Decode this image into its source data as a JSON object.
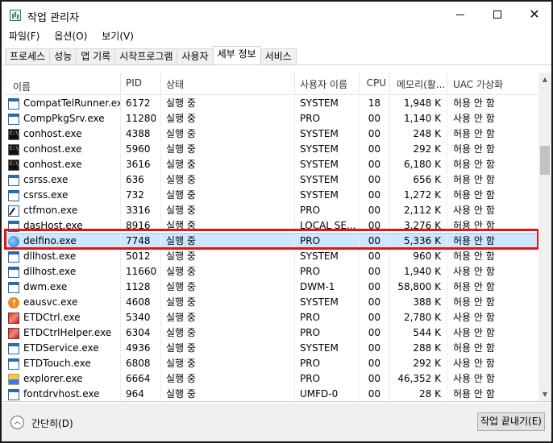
{
  "window": {
    "title": "작업 관리자"
  },
  "menu": [
    "파일(F)",
    "옵션(O)",
    "보기(V)"
  ],
  "tabs": [
    "프로세스",
    "성능",
    "앱 기록",
    "시작프로그램",
    "사용자",
    "세부 정보",
    "서비스"
  ],
  "active_tab": "세부 정보",
  "columns": {
    "name": "이름",
    "pid": "PID",
    "state": "상태",
    "user": "사용자 이름",
    "cpu": "CPU",
    "mem": "메모리(활...",
    "uac": "UAC 가상화"
  },
  "rows": [
    {
      "icon": "window-icon",
      "name": "CompatTelRunner.exe",
      "pid": "6172",
      "state": "실행 중",
      "user": "SYSTEM",
      "cpu": "18",
      "mem": "1,948 K",
      "uac": "허용 안 함"
    },
    {
      "icon": "window-icon",
      "name": "CompPkgSrv.exe",
      "pid": "11280",
      "state": "실행 중",
      "user": "PRO",
      "cpu": "00",
      "mem": "1,140 K",
      "uac": "사용 안 함"
    },
    {
      "icon": "console-icon",
      "name": "conhost.exe",
      "pid": "4388",
      "state": "실행 중",
      "user": "SYSTEM",
      "cpu": "00",
      "mem": "248 K",
      "uac": "허용 안 함"
    },
    {
      "icon": "console-icon",
      "name": "conhost.exe",
      "pid": "5960",
      "state": "실행 중",
      "user": "SYSTEM",
      "cpu": "00",
      "mem": "292 K",
      "uac": "허용 안 함"
    },
    {
      "icon": "console-icon",
      "name": "conhost.exe",
      "pid": "3616",
      "state": "실행 중",
      "user": "SYSTEM",
      "cpu": "00",
      "mem": "6,180 K",
      "uac": "허용 안 함"
    },
    {
      "icon": "window-icon",
      "name": "csrss.exe",
      "pid": "636",
      "state": "실행 중",
      "user": "SYSTEM",
      "cpu": "00",
      "mem": "656 K",
      "uac": "허용 안 함"
    },
    {
      "icon": "window-icon",
      "name": "csrss.exe",
      "pid": "732",
      "state": "실행 중",
      "user": "SYSTEM",
      "cpu": "00",
      "mem": "1,272 K",
      "uac": "허용 안 함"
    },
    {
      "icon": "pen-icon",
      "name": "ctfmon.exe",
      "pid": "3316",
      "state": "실행 중",
      "user": "PRO",
      "cpu": "00",
      "mem": "2,112 K",
      "uac": "사용 안 함"
    },
    {
      "icon": "window-icon",
      "name": "dasHost.exe",
      "pid": "8916",
      "state": "실행 중",
      "user": "LOCAL SE...",
      "cpu": "00",
      "mem": "3,276 K",
      "uac": "허용 안 함"
    },
    {
      "icon": "globe-icon",
      "name": "delfino.exe",
      "pid": "7748",
      "state": "실행 중",
      "user": "PRO",
      "cpu": "00",
      "mem": "5,336 K",
      "uac": "허용 안 함",
      "selected": true
    },
    {
      "icon": "window-icon",
      "name": "dllhost.exe",
      "pid": "5012",
      "state": "실행 중",
      "user": "SYSTEM",
      "cpu": "00",
      "mem": "960 K",
      "uac": "허용 안 함"
    },
    {
      "icon": "window-icon",
      "name": "dllhost.exe",
      "pid": "11660",
      "state": "실행 중",
      "user": "PRO",
      "cpu": "00",
      "mem": "1,940 K",
      "uac": "사용 안 함"
    },
    {
      "icon": "window-icon",
      "name": "dwm.exe",
      "pid": "1128",
      "state": "실행 중",
      "user": "DWM-1",
      "cpu": "00",
      "mem": "58,800 K",
      "uac": "허용 안 함"
    },
    {
      "icon": "update-icon",
      "name": "eausvc.exe",
      "pid": "4608",
      "state": "실행 중",
      "user": "SYSTEM",
      "cpu": "00",
      "mem": "388 K",
      "uac": "허용 안 함"
    },
    {
      "icon": "etd-icon",
      "name": "ETDCtrl.exe",
      "pid": "5340",
      "state": "실행 중",
      "user": "PRO",
      "cpu": "00",
      "mem": "2,780 K",
      "uac": "사용 안 함"
    },
    {
      "icon": "etd-icon",
      "name": "ETDCtrlHelper.exe",
      "pid": "6304",
      "state": "실행 중",
      "user": "PRO",
      "cpu": "00",
      "mem": "544 K",
      "uac": "사용 안 함"
    },
    {
      "icon": "window-icon",
      "name": "ETDService.exe",
      "pid": "4936",
      "state": "실행 중",
      "user": "SYSTEM",
      "cpu": "00",
      "mem": "288 K",
      "uac": "허용 안 함"
    },
    {
      "icon": "window-icon",
      "name": "ETDTouch.exe",
      "pid": "6808",
      "state": "실행 중",
      "user": "PRO",
      "cpu": "00",
      "mem": "292 K",
      "uac": "사용 안 함"
    },
    {
      "icon": "folder-icon",
      "name": "explorer.exe",
      "pid": "6664",
      "state": "실행 중",
      "user": "PRO",
      "cpu": "00",
      "mem": "46,352 K",
      "uac": "사용 안 함"
    },
    {
      "icon": "window-icon",
      "name": "fontdrvhost.exe",
      "pid": "964",
      "state": "실행 중",
      "user": "UMFD-0",
      "cpu": "00",
      "mem": "28 K",
      "uac": "허용 안 함"
    }
  ],
  "footer": {
    "less_label": "간단히(D)",
    "end_task": "작업 끝내기(E)"
  }
}
